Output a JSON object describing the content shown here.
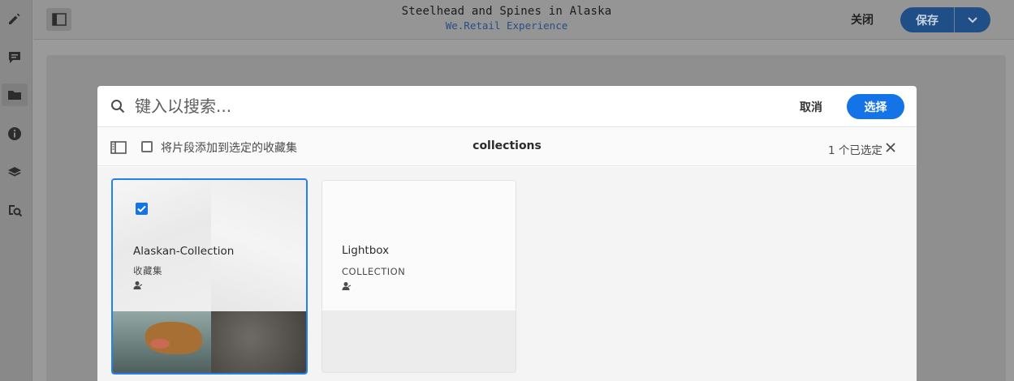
{
  "header": {
    "title": "Steelhead and Spines in Alaska",
    "subtitle": "We.Retail Experience",
    "close_label": "关闭",
    "save_label": "保存"
  },
  "rail": {
    "icons": [
      "pencil-icon",
      "comment-icon",
      "folder-icon",
      "info-icon",
      "layers-icon",
      "asset-search-icon"
    ]
  },
  "dialog": {
    "search_placeholder": "键入以搜索...",
    "cancel_label": "取消",
    "select_label": "选择",
    "add_label": "将片段添加到选定的收藏集",
    "breadcrumb": "collections",
    "selected_count": "1 个已选定",
    "accent_color": "#1473e6"
  },
  "cards": [
    {
      "title": "Alaskan-Collection",
      "type": "收藏集",
      "selected": true
    },
    {
      "title": "Lightbox",
      "type": "COLLECTION",
      "selected": false
    }
  ]
}
